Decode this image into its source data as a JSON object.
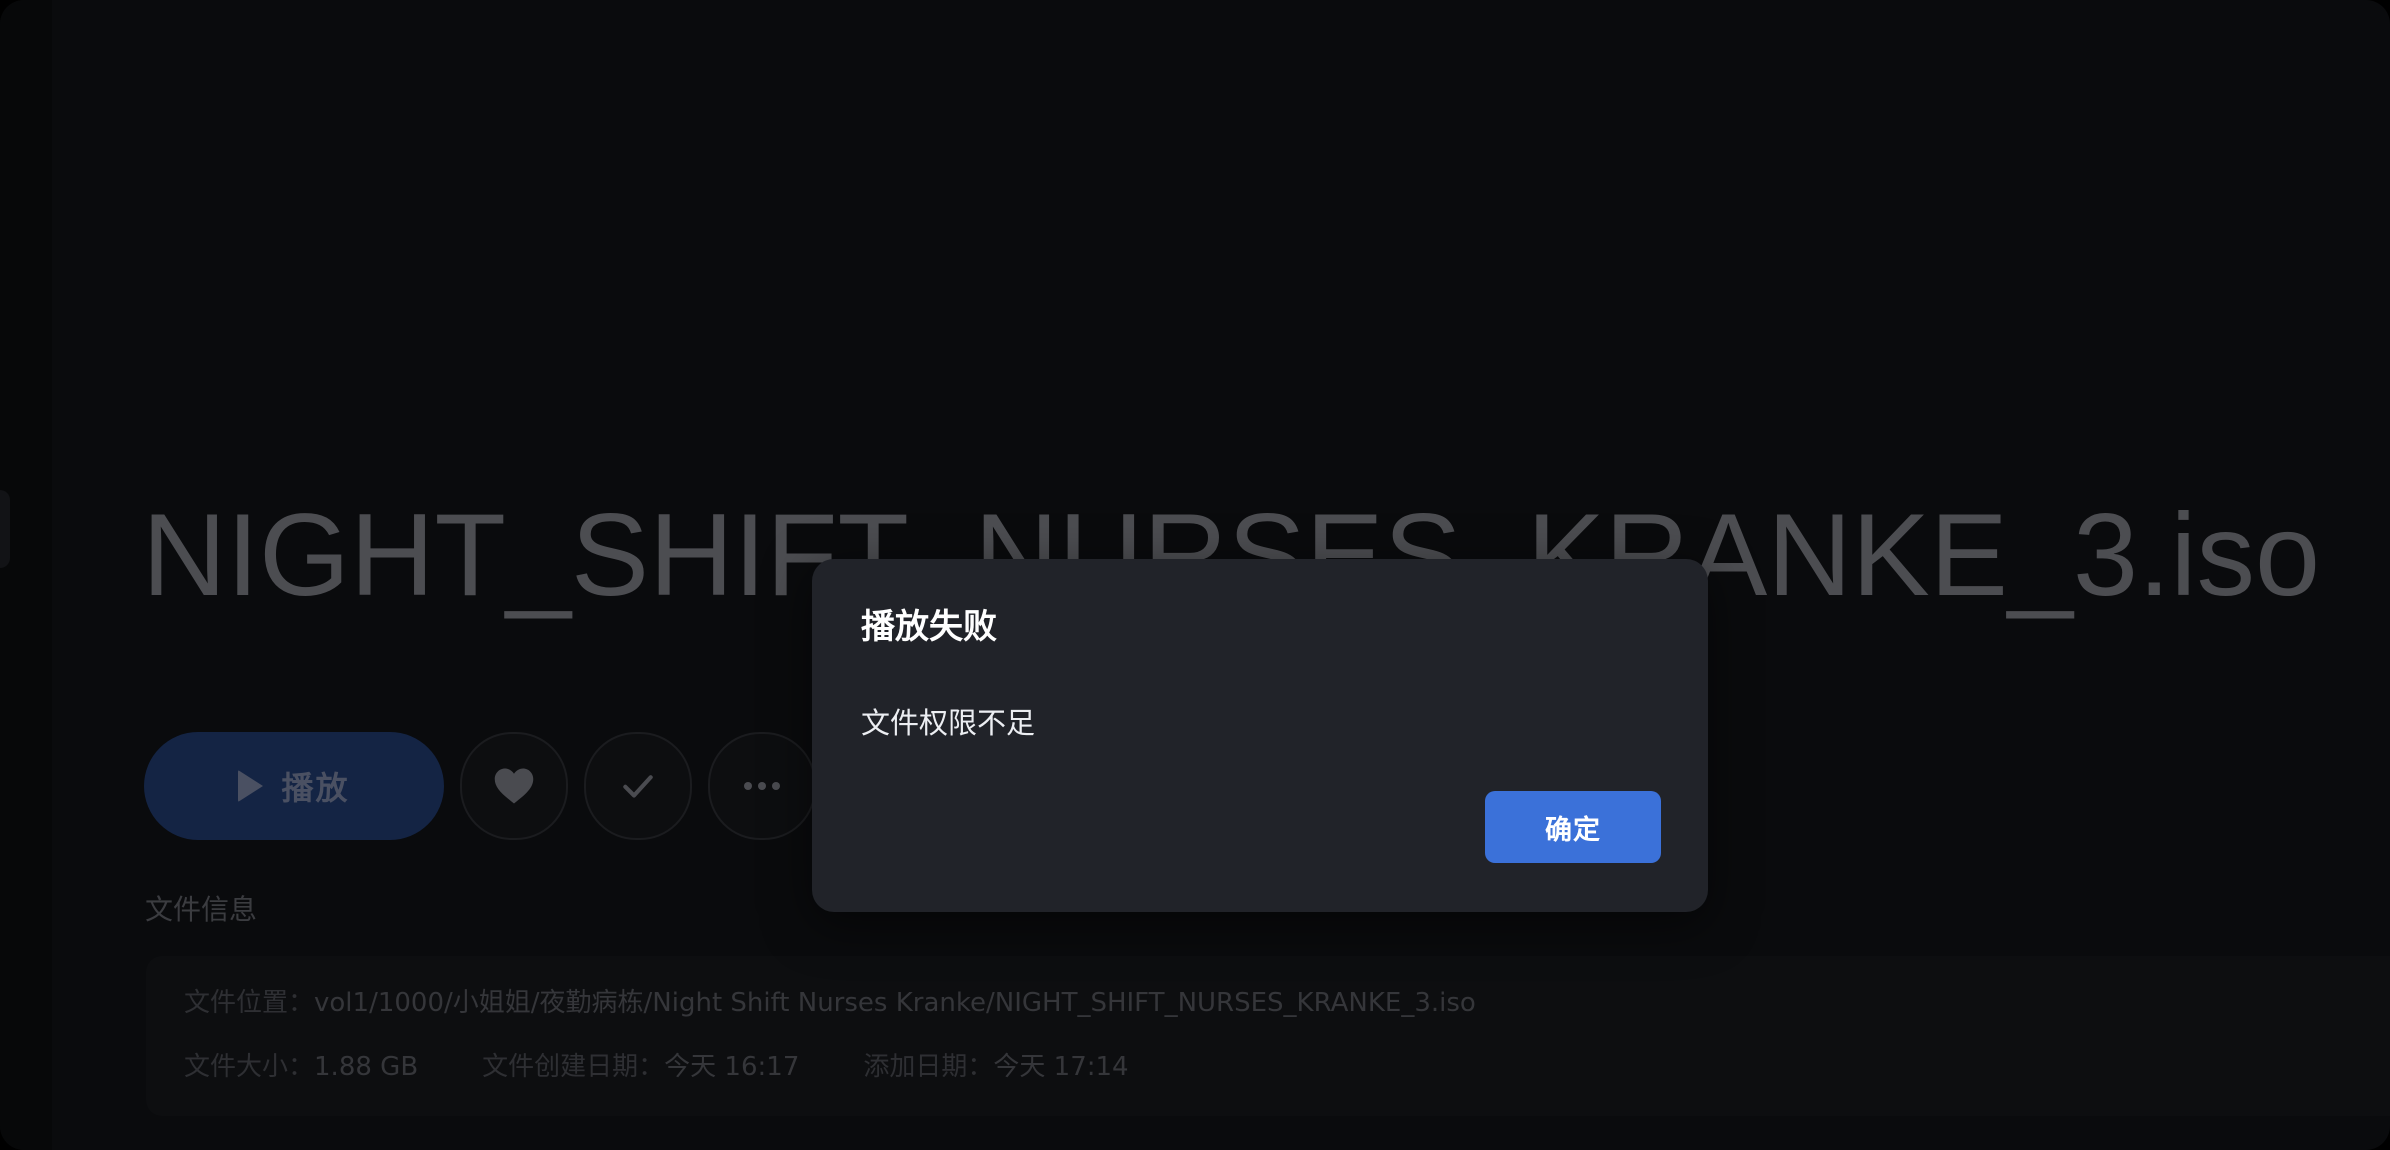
{
  "media": {
    "title": "NIGHT_SHIFT_NURSES_KRANKE_3.iso"
  },
  "actions": {
    "play_label": "播放",
    "favorite_icon": "heart-icon",
    "watched_icon": "check-icon",
    "more_icon": "more-horizontal-icon"
  },
  "file_info": {
    "section_label": "文件信息",
    "location_label": "文件位置：",
    "location_value": "vol1/1000/小姐姐/夜勤病栋/Night Shift Nurses Kranke/NIGHT_SHIFT_NURSES_KRANKE_3.iso",
    "size_label": "文件大小：",
    "size_value": "1.88 GB",
    "created_label": "文件创建日期：",
    "created_value": "今天 16:17",
    "added_label": "添加日期：",
    "added_value": "今天 17:14"
  },
  "dialog": {
    "title": "播放失败",
    "message": "文件权限不足",
    "confirm_label": "确定"
  },
  "colors": {
    "background": "#0a0b0d",
    "dialog_background": "#212329",
    "accent": "#3b71d9"
  }
}
